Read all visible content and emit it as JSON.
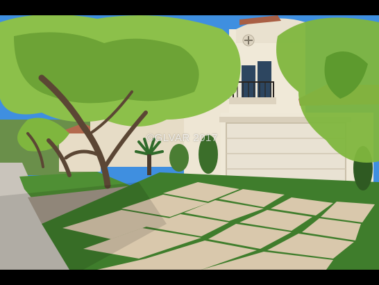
{
  "photo": {
    "watermark": "©GLVAR 2017"
  },
  "colors": {
    "sky": "#3f8fe0",
    "stucco": "#ece4d2",
    "roof": "#b46a4e",
    "garage": "#e9e2d3",
    "pavers": "#d9c8ac",
    "turf": "#3f7d2c",
    "foliage": "#7fb63e",
    "trunk": "#5b4634",
    "sidewalk": "#c9c4bb"
  }
}
